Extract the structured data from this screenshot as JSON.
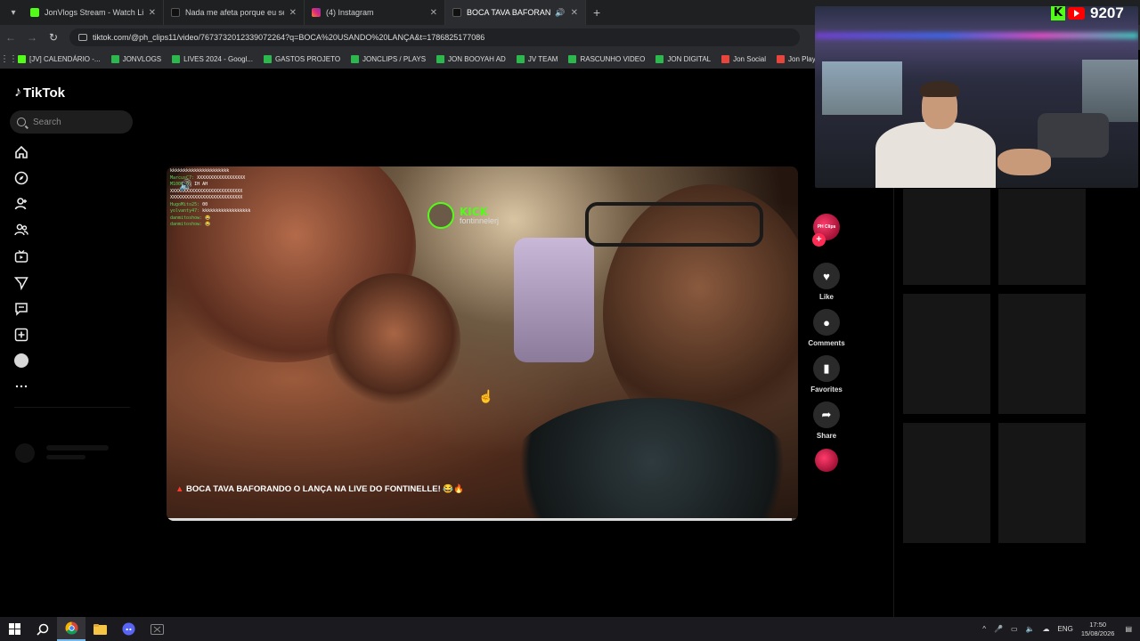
{
  "browser": {
    "tabs": [
      {
        "label": "JonVlogs Stream - Watch Live o",
        "favicon_color": "#53fc18",
        "active": false
      },
      {
        "label": "Nada me afeta porque eu semp",
        "favicon_color": "#222222",
        "active": false
      },
      {
        "label": "(4) Instagram",
        "favicon_color": "#e1306c",
        "active": false
      },
      {
        "label": "BOCA TAVA BAFORANDO",
        "favicon_color": "#222222",
        "active": true
      }
    ],
    "url": "tiktok.com/@ph_clips11/video/7673732012339072264?q=BOCA%20USANDO%20LANÇA&t=1786825177086",
    "bookmarks": [
      {
        "label": "[JV] CALENDÁRIO -...",
        "color": "#53fc18"
      },
      {
        "label": "JONVLOGS",
        "color": "#2db84d"
      },
      {
        "label": "LIVES 2024 - Googl...",
        "color": "#2db84d"
      },
      {
        "label": "GASTOS PROJETO",
        "color": "#2db84d"
      },
      {
        "label": "JONCLIPS / PLAYS",
        "color": "#2db84d"
      },
      {
        "label": "JON BOOYAH AD",
        "color": "#2db84d"
      },
      {
        "label": "JV TEAM",
        "color": "#2db84d"
      },
      {
        "label": "RASCUNHO VIDEO",
        "color": "#2db84d"
      },
      {
        "label": "JON DIGITAL",
        "color": "#2db84d"
      },
      {
        "label": "Jon Social",
        "color": "#e8453c"
      },
      {
        "label": "Jon Plays",
        "color": "#e8453c"
      }
    ]
  },
  "tiktok": {
    "logo": "TikTok",
    "search_placeholder": "Search",
    "video": {
      "caption": "BOCA TAVA BAFORANDO O LANÇA NA LIVE DO FONTINELLE! 😂🔥",
      "kick_label": "KICK",
      "kick_channel": "fontinnelerj",
      "progress": 0.99,
      "chat_lines": [
        {
          "name": "",
          "text": "kkkkkkkkkkkkkkkkkkkkkk"
        },
        {
          "name": "MarcusC7:",
          "text": "XXXXXXXXXXXXXXXXXX"
        },
        {
          "name": "M1000_0:",
          "text": "IH AH"
        },
        {
          "name": "",
          "text": "XXXXXXXXXXXXXXXXXXXXXXXXXXX"
        },
        {
          "name": "",
          "text": "XXXXXXXXXXXXXXXXXXXXXXXXXXX"
        },
        {
          "name": "HugoMito25:",
          "text": "00"
        },
        {
          "name": "yolvanty47:",
          "text": "kkkkkkkkkkkkkkkkkk"
        },
        {
          "name": "danmitoshow:",
          "text": "😂"
        },
        {
          "name": "danmitoshow:",
          "text": "😂"
        }
      ]
    },
    "actions": {
      "like": "Like",
      "comments": "Comments",
      "favorites": "Favorites",
      "share": "Share",
      "creator_badge": "PH Clips"
    }
  },
  "overlay": {
    "viewer_count": "9207"
  },
  "taskbar": {
    "language": "ENG",
    "time": "17:50",
    "date": "15/08/2026"
  }
}
